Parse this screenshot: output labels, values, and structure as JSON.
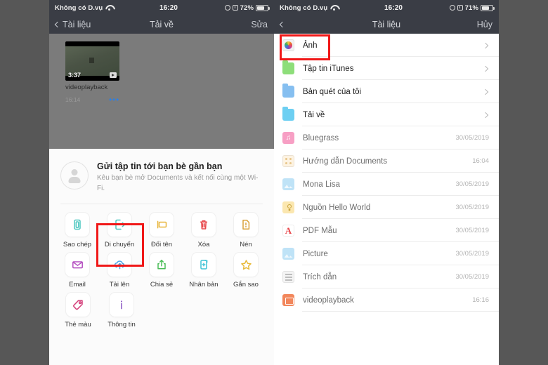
{
  "left": {
    "status": {
      "carrier": "Không có D.vụ",
      "time": "16:20",
      "battery": "72%"
    },
    "nav": {
      "back": "Tài liệu",
      "title": "Tải về",
      "action": "Sửa"
    },
    "file": {
      "name": "videoplayback",
      "duration": "3:37",
      "time": "16:14",
      "more": "•••"
    },
    "airdrop": {
      "title": "Gửi tập tin tới bạn bè gần bạn",
      "subtitle": "Kêu bạn bè mở Documents và kết nối cùng một Wi-Fi."
    },
    "actions": [
      [
        {
          "label": "Sao chép",
          "icon": "copy-icon",
          "color": "#4cc7c0"
        },
        {
          "label": "Di chuyển",
          "icon": "move-icon",
          "color": "#4cc7c0",
          "highlighted": true
        },
        {
          "label": "Đổi tên",
          "icon": "rename-icon",
          "color": "#e8b63c"
        },
        {
          "label": "Xóa",
          "icon": "trash-icon",
          "color": "#e8484c"
        },
        {
          "label": "Nén",
          "icon": "compress-icon",
          "color": "#d9a13a"
        }
      ],
      [
        {
          "label": "Email",
          "icon": "envelope-icon",
          "color": "#b44fc0"
        },
        {
          "label": "Tải lên",
          "icon": "cloud-up-icon",
          "color": "#4ba6e8"
        },
        {
          "label": "Chia sẻ",
          "icon": "share-icon",
          "color": "#4bbd58"
        },
        {
          "label": "Nhân bản",
          "icon": "duplicate-icon",
          "color": "#3fc3d6"
        },
        {
          "label": "Gắn sao",
          "icon": "star-icon",
          "color": "#e8bb3c"
        }
      ],
      [
        {
          "label": "Thẻ màu",
          "icon": "tag-icon",
          "color": "#d43f7a"
        },
        {
          "label": "Thông tin",
          "icon": "info-icon",
          "color": "#8a57c4"
        }
      ]
    ]
  },
  "right": {
    "status": {
      "carrier": "Không có D.vụ",
      "time": "16:20",
      "battery": "71%"
    },
    "nav": {
      "back": "",
      "title": "Tài liệu",
      "action": "Hủy"
    },
    "rows": [
      {
        "label": "Ảnh",
        "icon": "photos-icon",
        "color": "#f1f1f1",
        "kind": "photos",
        "chevron": true,
        "date": "",
        "highlighted": true
      },
      {
        "label": "Tập tin iTunes",
        "icon": "folder-icon",
        "color": "#8ede7a",
        "kind": "folder",
        "chevron": true,
        "date": ""
      },
      {
        "label": "Bản quét của tôi",
        "icon": "folder-icon",
        "color": "#86bff0",
        "kind": "folder",
        "chevron": true,
        "date": ""
      },
      {
        "label": "Tải về",
        "icon": "folder-icon",
        "color": "#6dcff2",
        "kind": "folder",
        "chevron": true,
        "date": ""
      },
      {
        "label": "Bluegrass",
        "icon": "music-icon",
        "color": "#f79fc4",
        "kind": "music",
        "chevron": false,
        "date": "30/05/2019",
        "dim": true
      },
      {
        "label": "Hướng dẫn Documents",
        "icon": "doc-icon",
        "color": "#fdf3e2",
        "kind": "dots",
        "chevron": false,
        "date": "16:04",
        "dim": true
      },
      {
        "label": "Mona Lisa",
        "icon": "image-icon",
        "color": "#bfe3f7",
        "kind": "img",
        "chevron": false,
        "date": "30/05/2019",
        "dim": true
      },
      {
        "label": "Nguồn Hello World",
        "icon": "key-icon",
        "color": "#fbe7b0",
        "kind": "key",
        "chevron": false,
        "date": "30/05/2019",
        "dim": true
      },
      {
        "label": "PDF Mẫu",
        "icon": "pdf-icon",
        "color": "#ffffff",
        "kind": "pdf",
        "chevron": false,
        "date": "30/05/2019",
        "dim": true
      },
      {
        "label": "Picture",
        "icon": "image-icon",
        "color": "#bfe3f7",
        "kind": "img",
        "chevron": false,
        "date": "30/05/2019",
        "dim": true
      },
      {
        "label": "Trích dẫn",
        "icon": "text-icon",
        "color": "#f4f4f4",
        "kind": "lines",
        "chevron": false,
        "date": "30/05/2019",
        "dim": true
      },
      {
        "label": "videoplayback",
        "icon": "video-icon",
        "color": "#f2875c",
        "kind": "video",
        "chevron": false,
        "date": "16:16",
        "dim": true
      }
    ]
  }
}
